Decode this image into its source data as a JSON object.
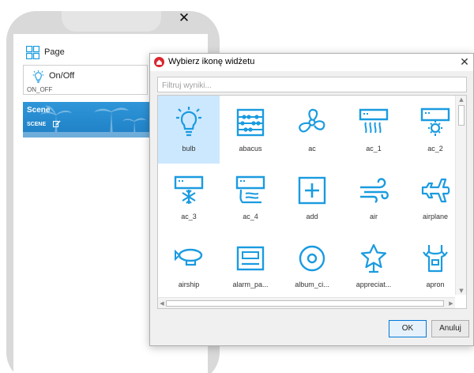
{
  "phone": {
    "close_glyph": "✕",
    "page_row": {
      "label": "Page",
      "icon": "grid-icon"
    },
    "onoff_widget": {
      "label": "On/Off",
      "sublabel": "ON_OFF",
      "icon": "bulb-icon"
    },
    "scene_card": {
      "title": "Scene",
      "sublabel": "SCENE",
      "icon": "edit-icon"
    }
  },
  "dialog": {
    "title": "Wybierz ikonę widżetu",
    "close_glyph": "✕",
    "filter_placeholder": "Filtruj wyniki...",
    "icons": [
      {
        "label": "bulb",
        "icon": "bulb",
        "selected": true
      },
      {
        "label": "abacus",
        "icon": "abacus"
      },
      {
        "label": "ac",
        "icon": "fan"
      },
      {
        "label": "ac_1",
        "icon": "ac-1"
      },
      {
        "label": "ac_2",
        "icon": "ac-2"
      },
      {
        "label": "ac_3",
        "icon": "ac-3"
      },
      {
        "label": "ac_4",
        "icon": "ac-4"
      },
      {
        "label": "add",
        "icon": "add"
      },
      {
        "label": "air",
        "icon": "air"
      },
      {
        "label": "airplane",
        "icon": "airplane"
      },
      {
        "label": "airship",
        "icon": "airship"
      },
      {
        "label": "alarm_pa...",
        "icon": "alarm-panel"
      },
      {
        "label": "album_ci...",
        "icon": "album-circle"
      },
      {
        "label": "appreciat...",
        "icon": "appreciation"
      },
      {
        "label": "apron",
        "icon": "apron"
      }
    ],
    "ok_label": "OK",
    "cancel_label": "Anuluj"
  },
  "colors": {
    "icon_blue": "#1a9be0",
    "selection": "#cce8ff",
    "scene_bg": "#2388cf",
    "app_icon_red": "#d9262e"
  }
}
